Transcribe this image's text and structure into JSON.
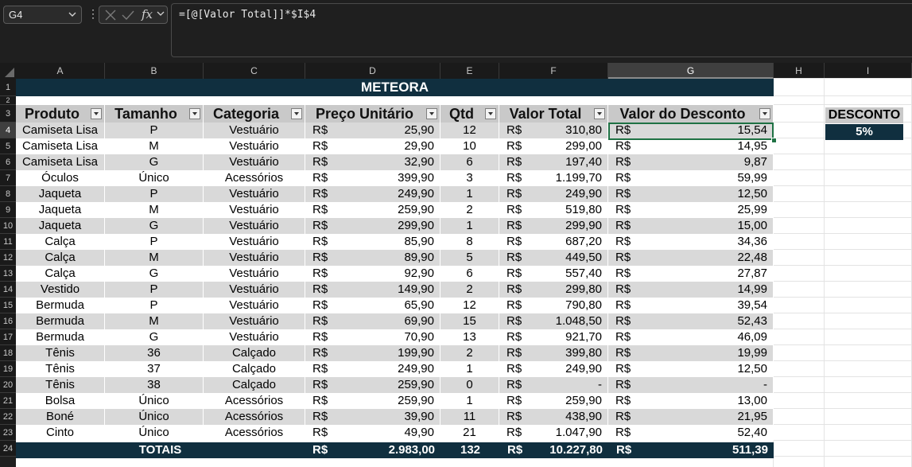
{
  "name_box": {
    "value": "G4"
  },
  "formula": {
    "text": "=[@[Valor Total]]*$I$4",
    "fx_label": "fx"
  },
  "columns": [
    "A",
    "B",
    "C",
    "D",
    "E",
    "F",
    "G",
    "H",
    "I"
  ],
  "selected_column": "G",
  "row_numbers": [
    "1",
    "2",
    "3",
    "4",
    "5",
    "6",
    "7",
    "8",
    "9",
    "10",
    "11",
    "12",
    "13",
    "14",
    "15",
    "16",
    "17",
    "18",
    "19",
    "20",
    "21",
    "22",
    "23",
    "24"
  ],
  "selected_row": "4",
  "table": {
    "title": "METEORA",
    "headers": [
      "Produto",
      "Tamanho",
      "Categoria",
      "Preço Unitário",
      "Qtd",
      "Valor Total",
      "Valor do Desconto"
    ],
    "currency": "R$",
    "rows": [
      {
        "produto": "Camiseta Lisa",
        "tamanho": "P",
        "categoria": "Vestuário",
        "preco": "25,90",
        "qtd": "12",
        "total": "310,80",
        "desconto": "15,54"
      },
      {
        "produto": "Camiseta Lisa",
        "tamanho": "M",
        "categoria": "Vestuário",
        "preco": "29,90",
        "qtd": "10",
        "total": "299,00",
        "desconto": "14,95"
      },
      {
        "produto": "Camiseta Lisa",
        "tamanho": "G",
        "categoria": "Vestuário",
        "preco": "32,90",
        "qtd": "6",
        "total": "197,40",
        "desconto": "9,87"
      },
      {
        "produto": "Óculos",
        "tamanho": "Único",
        "categoria": "Acessórios",
        "preco": "399,90",
        "qtd": "3",
        "total": "1.199,70",
        "desconto": "59,99"
      },
      {
        "produto": "Jaqueta",
        "tamanho": "P",
        "categoria": "Vestuário",
        "preco": "249,90",
        "qtd": "1",
        "total": "249,90",
        "desconto": "12,50"
      },
      {
        "produto": "Jaqueta",
        "tamanho": "M",
        "categoria": "Vestuário",
        "preco": "259,90",
        "qtd": "2",
        "total": "519,80",
        "desconto": "25,99"
      },
      {
        "produto": "Jaqueta",
        "tamanho": "G",
        "categoria": "Vestuário",
        "preco": "299,90",
        "qtd": "1",
        "total": "299,90",
        "desconto": "15,00"
      },
      {
        "produto": "Calça",
        "tamanho": "P",
        "categoria": "Vestuário",
        "preco": "85,90",
        "qtd": "8",
        "total": "687,20",
        "desconto": "34,36"
      },
      {
        "produto": "Calça",
        "tamanho": "M",
        "categoria": "Vestuário",
        "preco": "89,90",
        "qtd": "5",
        "total": "449,50",
        "desconto": "22,48"
      },
      {
        "produto": "Calça",
        "tamanho": "G",
        "categoria": "Vestuário",
        "preco": "92,90",
        "qtd": "6",
        "total": "557,40",
        "desconto": "27,87"
      },
      {
        "produto": "Vestido",
        "tamanho": "P",
        "categoria": "Vestuário",
        "preco": "149,90",
        "qtd": "2",
        "total": "299,80",
        "desconto": "14,99"
      },
      {
        "produto": "Bermuda",
        "tamanho": "P",
        "categoria": "Vestuário",
        "preco": "65,90",
        "qtd": "12",
        "total": "790,80",
        "desconto": "39,54"
      },
      {
        "produto": "Bermuda",
        "tamanho": "M",
        "categoria": "Vestuário",
        "preco": "69,90",
        "qtd": "15",
        "total": "1.048,50",
        "desconto": "52,43"
      },
      {
        "produto": "Bermuda",
        "tamanho": "G",
        "categoria": "Vestuário",
        "preco": "70,90",
        "qtd": "13",
        "total": "921,70",
        "desconto": "46,09"
      },
      {
        "produto": "Tênis",
        "tamanho": "36",
        "categoria": "Calçado",
        "preco": "199,90",
        "qtd": "2",
        "total": "399,80",
        "desconto": "19,99"
      },
      {
        "produto": "Tênis",
        "tamanho": "37",
        "categoria": "Calçado",
        "preco": "249,90",
        "qtd": "1",
        "total": "249,90",
        "desconto": "12,50"
      },
      {
        "produto": "Tênis",
        "tamanho": "38",
        "categoria": "Calçado",
        "preco": "259,90",
        "qtd": "0",
        "total": "-",
        "desconto": "-"
      },
      {
        "produto": "Bolsa",
        "tamanho": "Único",
        "categoria": "Acessórios",
        "preco": "259,90",
        "qtd": "1",
        "total": "259,90",
        "desconto": "13,00"
      },
      {
        "produto": "Boné",
        "tamanho": "Único",
        "categoria": "Acessórios",
        "preco": "39,90",
        "qtd": "11",
        "total": "438,90",
        "desconto": "21,95"
      },
      {
        "produto": "Cinto",
        "tamanho": "Único",
        "categoria": "Acessórios",
        "preco": "49,90",
        "qtd": "21",
        "total": "1.047,90",
        "desconto": "52,40"
      }
    ],
    "totals": {
      "label": "TOTAIS",
      "preco": "2.983,00",
      "qtd": "132",
      "total": "10.227,80",
      "desconto": "511,39"
    }
  },
  "discount": {
    "label": "DESCONTO",
    "value": "5%"
  },
  "colors": {
    "dark_teal": "#102f3f",
    "band": "#d9d9d9",
    "header_gray": "#c9c9c9",
    "selection": "#1f7244"
  }
}
